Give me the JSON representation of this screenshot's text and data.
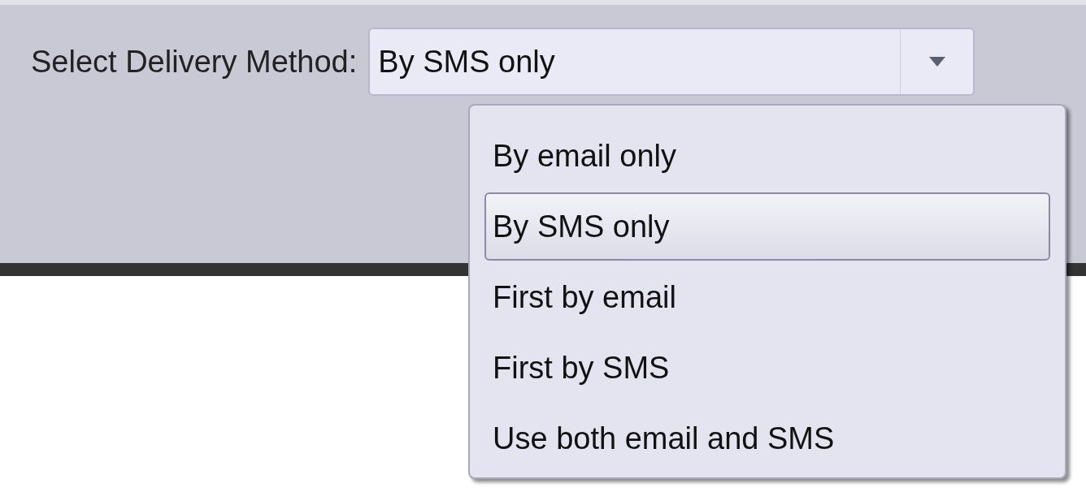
{
  "label": "Select Delivery Method:",
  "combo": {
    "value": "By SMS only",
    "expanded": true
  },
  "options": [
    {
      "label": "By email only",
      "selected": false
    },
    {
      "label": "By SMS only",
      "selected": true
    },
    {
      "label": "First by email",
      "selected": false
    },
    {
      "label": "First by SMS",
      "selected": false
    },
    {
      "label": "Use both email and SMS",
      "selected": false
    }
  ]
}
